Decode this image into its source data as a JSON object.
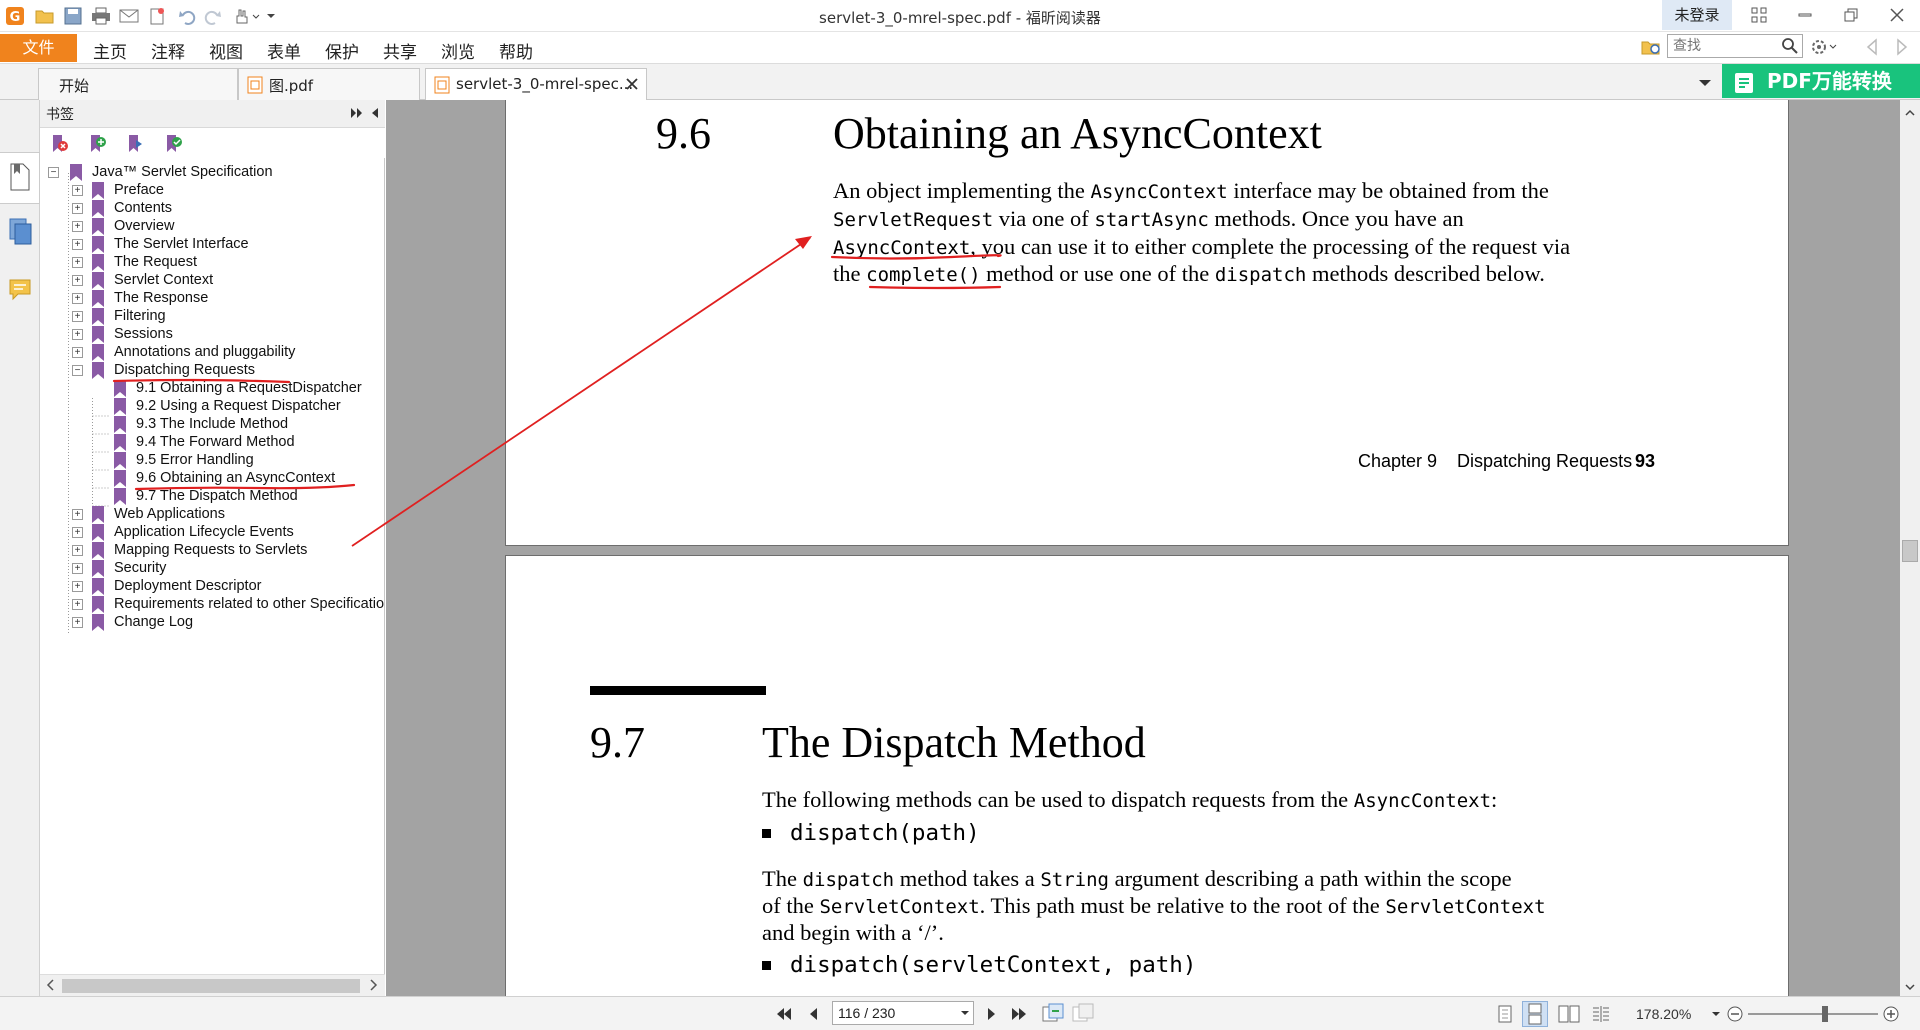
{
  "window": {
    "title": "servlet-3_0-mrel-spec.pdf - 福昕阅读器",
    "login": "未登录"
  },
  "menu": {
    "file": "文件",
    "items": [
      "主页",
      "注释",
      "视图",
      "表单",
      "保护",
      "共享",
      "浏览",
      "帮助"
    ],
    "search_placeholder": "查找"
  },
  "tabs": [
    {
      "label": "开始"
    },
    {
      "label": "图.pdf"
    },
    {
      "label": "servlet-3_0-mrel-spec..."
    }
  ],
  "promo": {
    "label": "PDF万能转换"
  },
  "bookmarks": {
    "title": "书签",
    "items": [
      {
        "label": "Java™ Servlet Specification"
      },
      {
        "label": "Preface"
      },
      {
        "label": "Contents"
      },
      {
        "label": "Overview"
      },
      {
        "label": "The Servlet Interface"
      },
      {
        "label": "The Request"
      },
      {
        "label": "Servlet Context"
      },
      {
        "label": "The Response"
      },
      {
        "label": "Filtering"
      },
      {
        "label": "Sessions"
      },
      {
        "label": "Annotations and pluggability"
      },
      {
        "label": "Dispatching Requests"
      },
      {
        "label": "9.1 Obtaining a RequestDispatcher"
      },
      {
        "label": "9.2 Using a Request Dispatcher"
      },
      {
        "label": "9.3 The Include Method"
      },
      {
        "label": "9.4 The Forward Method"
      },
      {
        "label": "9.5 Error Handling"
      },
      {
        "label": "9.6 Obtaining an AsyncContext"
      },
      {
        "label": "9.7 The Dispatch Method"
      },
      {
        "label": "Web Applications"
      },
      {
        "label": "Application Lifecycle Events"
      },
      {
        "label": "Mapping Requests to Servlets"
      },
      {
        "label": "Security"
      },
      {
        "label": "Deployment Descriptor"
      },
      {
        "label": "Requirements related to other Specifications"
      },
      {
        "label": "Change Log"
      }
    ]
  },
  "page1": {
    "section_number": "9.6",
    "section_title": "Obtaining an AsyncContext",
    "p": {
      "t1": "An object implementing the ",
      "c1": "AsyncContext",
      "t2": " interface may be obtained from the",
      "c2": "ServletRequest",
      "t3": " via one of ",
      "c3": "startAsync",
      "t4": " methods. Once you have an",
      "c4": "AsyncContext",
      "t5": ", you can use it to either complete the processing of the request via",
      "t6": "the ",
      "c5": "complete()",
      "t7": " method or use one of the ",
      "c6": "dispatch",
      "t8": " methods described below."
    },
    "footer_chapter": "Chapter 9",
    "footer_title": "Dispatching Requests",
    "footer_page": "93"
  },
  "page2": {
    "section_number": "9.7",
    "section_title": "The Dispatch Method",
    "intro_text": "The following methods can be used to dispatch requests from the ",
    "intro_code": "AsyncContext",
    "intro_end": ":",
    "bullet1": "dispatch(path)",
    "p2": {
      "t1": "The ",
      "c1": "dispatch",
      "t2": "  method takes a ",
      "c2": "String",
      "t3": " argument describing a path within the scope",
      "t4": "of the ",
      "c3": "ServletContext",
      "t5": ". This path must be relative to the root of the ",
      "c4": "ServletContext",
      "t6": "and begin with a ‘/’."
    },
    "bullet2": "dispatch(servletContext, path)"
  },
  "status": {
    "page_indicator": "116 / 230",
    "zoom": "178.20%"
  },
  "colors": {
    "accent_orange": "#f0831d",
    "bookmark_purple": "#8a5aa5",
    "annotation_red": "#e02020",
    "promo_green": "#19c37d"
  }
}
